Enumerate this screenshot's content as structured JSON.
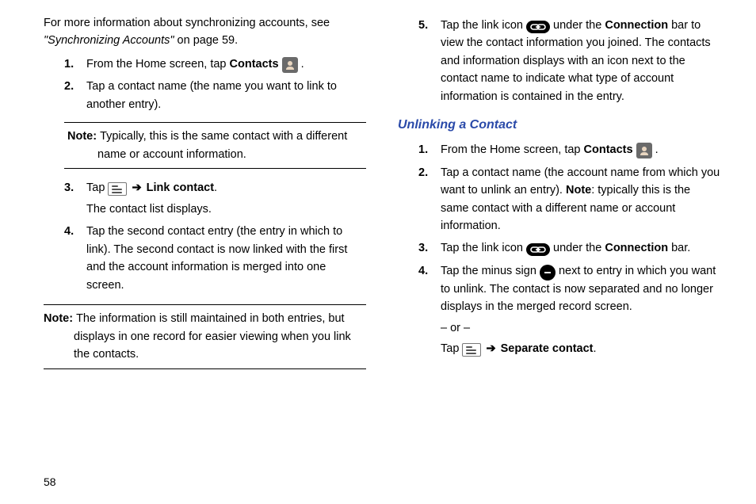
{
  "pageNumber": "58",
  "left": {
    "intro_a": "For more information about synchronizing accounts, see ",
    "intro_italic": "\"Synchronizing Accounts\"",
    "intro_b": " on page 59.",
    "s1_a": "From the Home screen, tap ",
    "s1_b": "Contacts",
    "s1_c": " .",
    "s2": "Tap a contact name (the name you want to link to another entry).",
    "note1_label": "Note:",
    "note1_body": "Typically, this is the same contact with a different name or account information.",
    "s3_a": "Tap ",
    "s3_b": "Link contact",
    "s3_c": ".",
    "s3_sub": "The contact list displays.",
    "s4": "Tap the second contact entry (the entry in which to link). The second contact is now linked with the first and the account information is merged into one screen.",
    "note2_label": "Note:",
    "note2_body": "The information is still maintained in both entries, but displays in one record for easier viewing when you link the contacts."
  },
  "right": {
    "s5_a": "Tap the link icon ",
    "s5_b": " under the ",
    "s5_c": "Connection",
    "s5_d": " bar to view the contact information you joined. The contacts and information displays with an icon next to the contact name to indicate what type of account information is contained in the entry.",
    "heading": "Unlinking a Contact",
    "u1_a": "From the Home screen, tap ",
    "u1_b": "Contacts",
    "u1_c": " .",
    "u2_a": "Tap a contact name (the account name from which you want to unlink an entry). ",
    "u2_b": "Note",
    "u2_c": ": typically this is the same contact with a different name or account information.",
    "u3_a": "Tap the link icon ",
    "u3_b": " under the ",
    "u3_c": "Connection",
    "u3_d": " bar.",
    "u4_a": "Tap the minus sign ",
    "u4_b": " next to entry in which you want to unlink. The contact is now separated and no longer displays in the merged record screen.",
    "u4_or": "– or –",
    "u4_tap": "Tap ",
    "u4_sep": "Separate contact",
    "u4_dot": "."
  },
  "icons": {
    "contacts": "contacts-icon",
    "menu": "menu-icon",
    "link": "link-icon",
    "minus": "minus-icon",
    "arrow": "➔"
  }
}
